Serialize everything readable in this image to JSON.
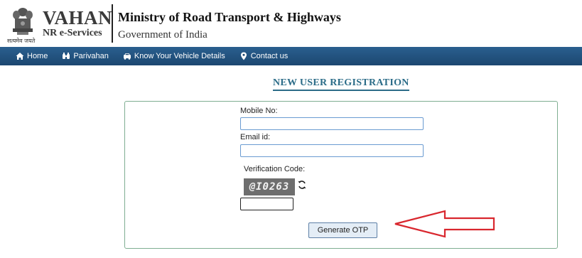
{
  "header": {
    "emblem_motto": "सत्यमेव जयते",
    "brand_title": "VAHAN",
    "brand_subtitle": "NR e-Services",
    "ministry": "Ministry of Road Transport & Highways",
    "government": "Government of India"
  },
  "nav": {
    "items": [
      {
        "label": "Home",
        "icon": "home-icon"
      },
      {
        "label": "Parivahan",
        "icon": "binoculars-icon"
      },
      {
        "label": "Know Your Vehicle Details",
        "icon": "car-icon"
      },
      {
        "label": "Contact us",
        "icon": "map-pin-icon"
      }
    ]
  },
  "form": {
    "title": "NEW USER REGISTRATION",
    "mobile_label": "Mobile No:",
    "mobile_value": "",
    "email_label": "Email id:",
    "email_value": "",
    "verification_label": "Verification Code:",
    "captcha_text": "@I0263",
    "captcha_value": "",
    "generate_otp_label": "Generate OTP"
  },
  "colors": {
    "nav_bar": "#1c4770",
    "title_accent": "#2b6c88",
    "panel_border": "#7fae91",
    "arrow": "#d9272e"
  }
}
